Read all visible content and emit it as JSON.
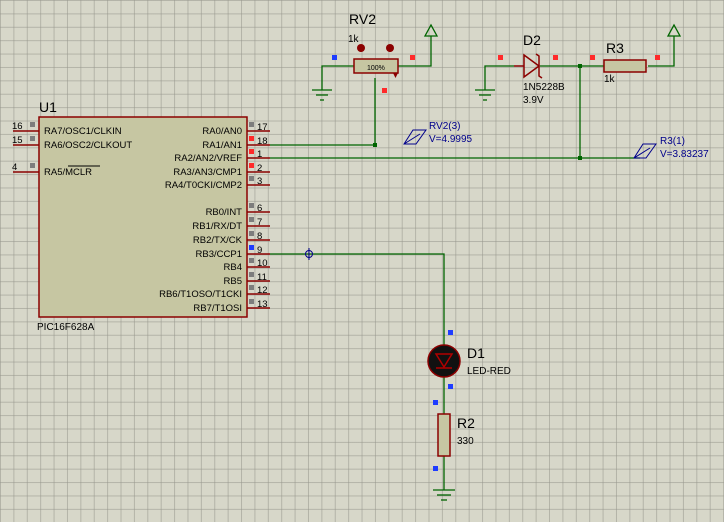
{
  "u1": {
    "ref": "U1",
    "part": "PIC16F628A",
    "left_pins": [
      {
        "num": "16",
        "label": "RA7/OSC1/CLKIN"
      },
      {
        "num": "15",
        "label": "RA6/OSC2/CLKOUT"
      },
      {
        "num": "4",
        "label": "RA5/MCLR"
      }
    ],
    "right_pins": [
      {
        "num": "17",
        "label": "RA0/AN0"
      },
      {
        "num": "18",
        "label": "RA1/AN1"
      },
      {
        "num": "1",
        "label": "RA2/AN2/VREF"
      },
      {
        "num": "2",
        "label": "RA3/AN3/CMP1"
      },
      {
        "num": "3",
        "label": "RA4/T0CKI/CMP2"
      },
      {
        "num": "6",
        "label": "RB0/INT"
      },
      {
        "num": "7",
        "label": "RB1/RX/DT"
      },
      {
        "num": "8",
        "label": "RB2/TX/CK"
      },
      {
        "num": "9",
        "label": "RB3/CCP1"
      },
      {
        "num": "10",
        "label": "RB4"
      },
      {
        "num": "11",
        "label": "RB5"
      },
      {
        "num": "12",
        "label": "RB6/T1OSO/T1CKI"
      },
      {
        "num": "13",
        "label": "RB7/T1OSI"
      }
    ]
  },
  "rv2": {
    "ref": "RV2",
    "value": "1k",
    "percent": "100%"
  },
  "d2": {
    "ref": "D2",
    "part": "1N5228B",
    "value": "3.9V"
  },
  "r3": {
    "ref": "R3",
    "value": "1k"
  },
  "d1": {
    "ref": "D1",
    "part": "LED-RED"
  },
  "r2": {
    "ref": "R2",
    "value": "330"
  },
  "probes": {
    "rv2": {
      "name": "RV2(3)",
      "voltage": "V=4.9995"
    },
    "r3": {
      "name": "R3(1)",
      "voltage": "V=3.83237"
    }
  },
  "colors": {
    "wire": "#006400",
    "component": "#8b0000",
    "body_fill": "#c6c6a2",
    "probe": "#00008b"
  }
}
